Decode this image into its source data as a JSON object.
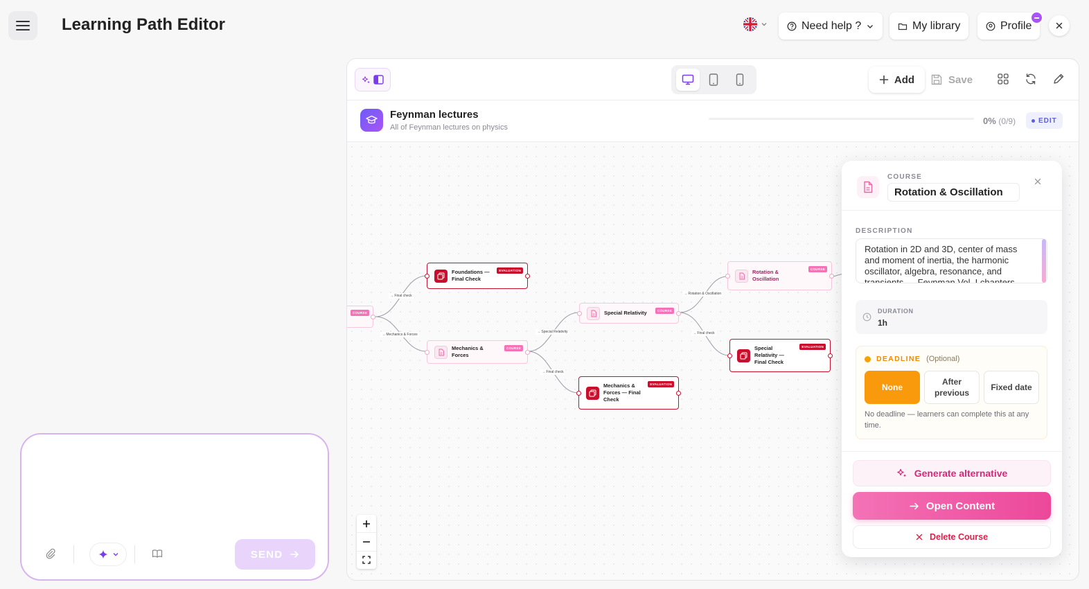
{
  "header": {
    "title": "Learning Path Editor",
    "help_label": "Need help ?",
    "library_label": "My library",
    "profile_label": "Profile"
  },
  "chat": {
    "send_label": "SEND"
  },
  "toolbar": {
    "add_label": "Add",
    "save_label": "Save"
  },
  "path": {
    "title": "Feynman lectures",
    "subtitle": "All of Feynman lectures on physics",
    "progress_pct": "0%",
    "progress_count": "(0/9)",
    "progress_fraction": 0,
    "edit_label": "EDIT"
  },
  "graph": {
    "nodes": [
      {
        "label": "",
        "tag": "COURSE"
      },
      {
        "label": "Foundations — Final Check",
        "tag": "EVALUATION"
      },
      {
        "label": "Mechanics & Forces",
        "tag": "COURSE"
      },
      {
        "label": "Special Relativity",
        "tag": "COURSE"
      },
      {
        "label": "Mechanics & Forces — Final Check",
        "tag": "EVALUATION"
      },
      {
        "label": "Rotation & Oscillation",
        "tag": "COURSE"
      },
      {
        "label": "Special Relativity — Final Check",
        "tag": "EVALUATION"
      }
    ],
    "edges": [
      {
        "label": "→ Final check"
      },
      {
        "label": "→ Mechanics & Forces"
      },
      {
        "label": "→ Special Relativity"
      },
      {
        "label": "→ Final check"
      },
      {
        "label": "→ Rotation & Oscillation"
      },
      {
        "label": "→ Final check"
      }
    ]
  },
  "panel": {
    "type_label": "COURSE",
    "title": "Rotation & Oscillation",
    "description_label": "DESCRIPTION",
    "description": "Rotation in 2D and 3D, center of mass and moment of inertia, the harmonic oscillator, algebra, resonance, and transients — Feynman Vol. I chapters",
    "duration_label": "DURATION",
    "duration_value": "1h",
    "deadline_label": "DEADLINE",
    "deadline_optional": "(Optional)",
    "deadline_options": [
      "None",
      "After previous",
      "Fixed date"
    ],
    "deadline_selected": "None",
    "deadline_note": "No deadline — learners can complete this at any time.",
    "generate_label": "Generate alternative",
    "open_label": "Open Content",
    "delete_label": "Delete Course"
  },
  "colors": {
    "accent_purple": "#a855f7",
    "course_pink": "#f472b6",
    "evaluation_red": "#c8102e",
    "deadline_orange": "#f99a0d",
    "delete_red": "#e11d48"
  }
}
